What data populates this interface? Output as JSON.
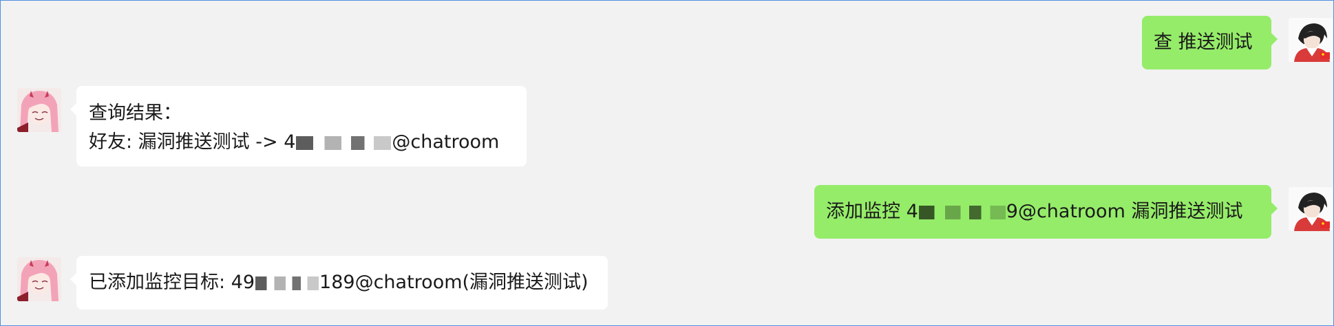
{
  "messages": [
    {
      "id": "m1",
      "direction": "outgoing",
      "sender_avatar": "red-jacket-anime-avatar",
      "lines": [
        "查 推送测试"
      ]
    },
    {
      "id": "m2",
      "direction": "incoming",
      "sender_avatar": "pink-hair-anime-avatar",
      "line1": "查询结果：",
      "line2_pre": "好友: 漏洞推送测试 -> 4",
      "line2_post": "@chatroom"
    },
    {
      "id": "m3",
      "direction": "outgoing",
      "sender_avatar": "red-jacket-anime-avatar",
      "pre": "添加监控 4",
      "post": "9@chatroom 漏洞推送测试"
    },
    {
      "id": "m4",
      "direction": "incoming",
      "sender_avatar": "pink-hair-anime-avatar",
      "pre": "已添加监控目标: 49",
      "post": "189@chatroom(漏洞推送测试)"
    }
  ],
  "colors": {
    "background": "#f2f2f2",
    "incoming_bubble": "#ffffff",
    "outgoing_bubble": "#95ec69",
    "window_border": "#4f8fe0",
    "text": "#1a1a1a"
  }
}
